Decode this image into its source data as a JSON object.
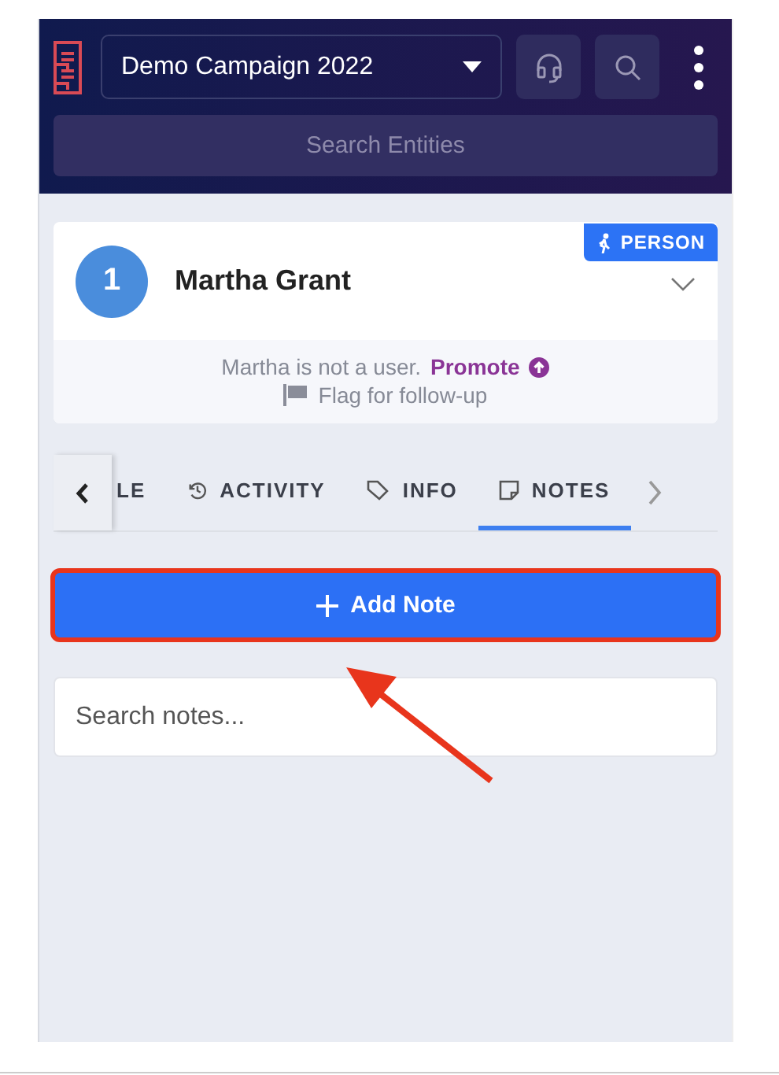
{
  "header": {
    "campaign": "Demo Campaign 2022",
    "search": {
      "placeholder": "Search Entities"
    }
  },
  "entity": {
    "number": "1",
    "name": "Martha Grant",
    "badge": "PERSON",
    "expanded": false,
    "status": "Martha is not a user.",
    "promote": "Promote",
    "flag": "Flag for follow-up"
  },
  "tabs": [
    {
      "label": "LE",
      "selected": false
    },
    {
      "label": "ACTIVITY",
      "selected": false
    },
    {
      "label": "INFO",
      "selected": false
    },
    {
      "label": "NOTES",
      "selected": true
    }
  ],
  "add_button": {
    "label": "Add Note",
    "highlighted": true
  },
  "notes_search": {
    "placeholder": "Search notes..."
  },
  "annotation": {
    "kind": "arrow"
  }
}
